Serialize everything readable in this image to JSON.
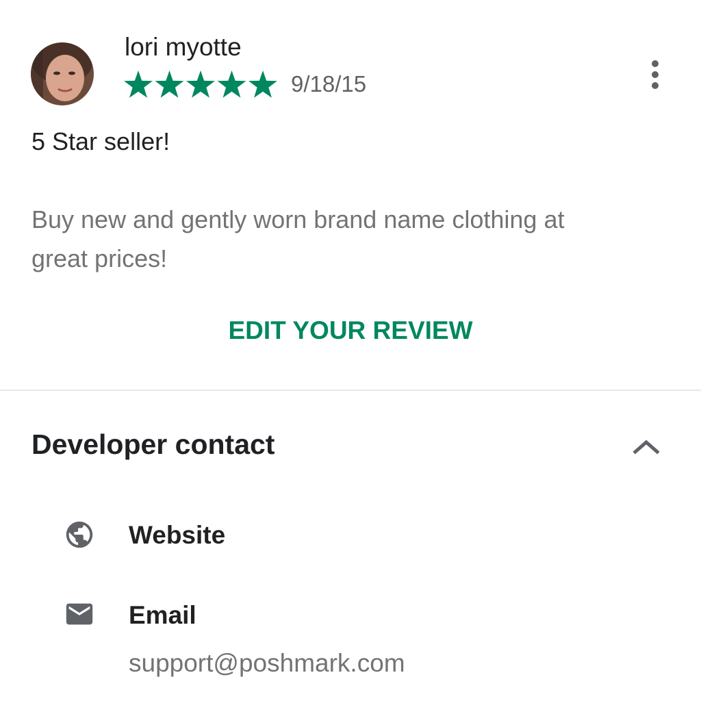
{
  "review": {
    "reviewer_name": "lori myotte",
    "rating": 5,
    "rating_max": 5,
    "date": "9/18/15",
    "title": "5 Star seller!",
    "body": "Buy new and gently worn brand name clothing at great prices!",
    "edit_label": "EDIT YOUR REVIEW",
    "more_icon": "more-vert-icon"
  },
  "developer_contact": {
    "title": "Developer contact",
    "collapse_icon": "chevron-up-icon",
    "items": [
      {
        "icon": "globe-icon",
        "label": "Website",
        "value": ""
      },
      {
        "icon": "email-icon",
        "label": "Email",
        "value": "support@poshmark.com"
      }
    ]
  },
  "colors": {
    "accent": "#01875f",
    "star": "#01875f",
    "text_primary": "#212121",
    "text_secondary": "#737373",
    "icon": "#5f6368",
    "divider": "#e6e6e6"
  }
}
